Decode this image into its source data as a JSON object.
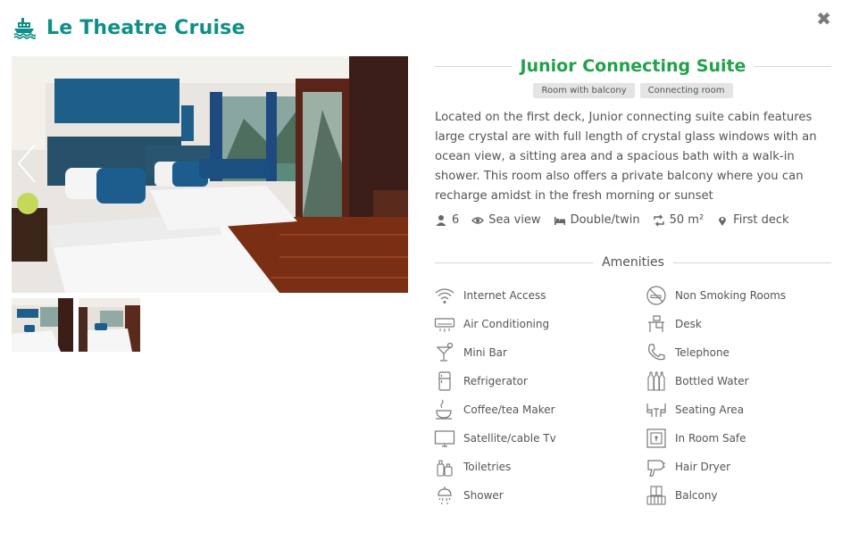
{
  "header": {
    "title": "Le Theatre Cruise"
  },
  "close_label": "✖",
  "room": {
    "title": "Junior Connecting Suite",
    "tags": [
      "Room with balcony",
      "Connecting room"
    ],
    "description": "Located on the first deck, Junior connecting suite cabin features large crystal are with full length of crystal glass windows with an ocean view, a sitting area and a spacious bath with a walk-in shower. This room also offers a private balcony where you can recharge amidst in the fresh morning or sunset",
    "specs": {
      "guests": "6",
      "view": "Sea view",
      "bed": "Double/twin",
      "size": "50 m²",
      "location": "First deck"
    }
  },
  "amenities_title": "Amenities",
  "amenities": [
    {
      "label": "Internet Access",
      "icon": "wifi-icon"
    },
    {
      "label": "Non Smoking Rooms",
      "icon": "no-smoking-icon"
    },
    {
      "label": "Air Conditioning",
      "icon": "air-conditioner-icon"
    },
    {
      "label": "Desk",
      "icon": "desk-icon"
    },
    {
      "label": "Mini Bar",
      "icon": "cocktail-icon"
    },
    {
      "label": "Telephone",
      "icon": "telephone-icon"
    },
    {
      "label": "Refrigerator",
      "icon": "refrigerator-icon"
    },
    {
      "label": "Bottled Water",
      "icon": "bottles-icon"
    },
    {
      "label": "Coffee/tea Maker",
      "icon": "coffee-cup-icon"
    },
    {
      "label": "Seating Area",
      "icon": "seating-area-icon"
    },
    {
      "label": "Satellite/cable Tv",
      "icon": "tv-icon"
    },
    {
      "label": "In Room Safe",
      "icon": "safe-icon"
    },
    {
      "label": "Toiletries",
      "icon": "toiletries-icon"
    },
    {
      "label": "Hair Dryer",
      "icon": "hair-dryer-icon"
    },
    {
      "label": "Shower",
      "icon": "shower-icon"
    },
    {
      "label": "Balcony",
      "icon": "balcony-icon"
    }
  ],
  "colors": {
    "brand": "#0f8f86",
    "room_title": "#21a24a",
    "text": "#555555",
    "tag_bg": "#e4e4e4"
  }
}
